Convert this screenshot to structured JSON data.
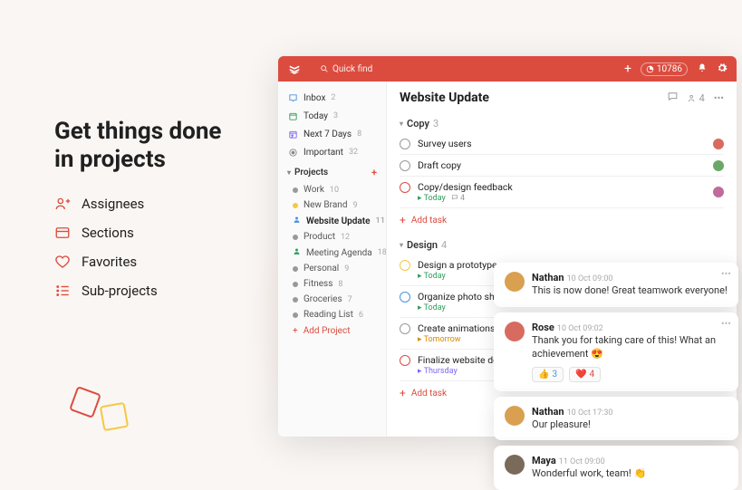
{
  "hero": {
    "title_line1": "Get things done",
    "title_line2": "in projects",
    "features": [
      {
        "icon": "assignees",
        "label": "Assignees"
      },
      {
        "icon": "sections",
        "label": "Sections"
      },
      {
        "icon": "favorites",
        "label": "Favorites"
      },
      {
        "icon": "subprojects",
        "label": "Sub-projects"
      }
    ]
  },
  "topbar": {
    "search_placeholder": "Quick find",
    "karma": "10786"
  },
  "sidebar": {
    "filters": [
      {
        "icon": "inbox",
        "label": "Inbox",
        "count": "2",
        "color": "#4a90e2"
      },
      {
        "icon": "today",
        "label": "Today",
        "count": "3",
        "color": "#2e9e5b"
      },
      {
        "icon": "next7",
        "label": "Next 7 Days",
        "count": "8",
        "color": "#7b68ee"
      },
      {
        "icon": "important",
        "label": "Important",
        "count": "32",
        "color": "#888"
      }
    ],
    "projects_header": "Projects",
    "projects": [
      {
        "label": "Work",
        "count": "10",
        "color": "#999",
        "icon": "dot"
      },
      {
        "label": "New Brand",
        "count": "9",
        "color": "#f5c842",
        "icon": "dot"
      },
      {
        "label": "Website Update",
        "count": "11",
        "color": "#4a90e2",
        "icon": "person",
        "active": true
      },
      {
        "label": "Product",
        "count": "12",
        "color": "#999",
        "icon": "dot"
      },
      {
        "label": "Meeting Agenda",
        "count": "18",
        "color": "#2e9e5b",
        "icon": "person"
      },
      {
        "label": "Personal",
        "count": "9",
        "color": "#999",
        "icon": "dot"
      },
      {
        "label": "Fitness",
        "count": "8",
        "color": "#999",
        "icon": "dot"
      },
      {
        "label": "Groceries",
        "count": "7",
        "color": "#999",
        "icon": "dot"
      },
      {
        "label": "Reading List",
        "count": "6",
        "color": "#999",
        "icon": "dot"
      }
    ],
    "add_project": "Add Project"
  },
  "main": {
    "title": "Website Update",
    "share_count": "4",
    "sections": [
      {
        "name": "Copy",
        "count": "3",
        "tasks": [
          {
            "label": "Survey users",
            "circle": "#999",
            "avatar": "#d86b5f"
          },
          {
            "label": "Draft copy",
            "circle": "#999",
            "avatar": "#6aa86a"
          },
          {
            "label": "Copy/design feedback",
            "circle": "#db4c3f",
            "date": "Today",
            "date_color": "#2e9e5b",
            "comments": "4",
            "avatar": "#c06b9a"
          }
        ],
        "add_label": "Add task"
      },
      {
        "name": "Design",
        "count": "4",
        "tasks": [
          {
            "label": "Design a prototype",
            "circle": "#f5c842",
            "date": "Today",
            "date_color": "#2e9e5b"
          },
          {
            "label": "Organize photo shoot",
            "circle": "#4a90e2",
            "date": "Today",
            "date_color": "#2e9e5b"
          },
          {
            "label": "Create animations",
            "circle": "#999",
            "date": "Tomorrow",
            "date_color": "#d28b00"
          },
          {
            "label": "Finalize website design",
            "circle": "#db4c3f",
            "date": "Thursday",
            "date_color": "#7b68ee"
          }
        ],
        "add_label": "Add task"
      }
    ]
  },
  "comments": [
    {
      "avatar": "#d8a050",
      "name": "Nathan",
      "time": "10 Oct 09:00",
      "text": "This is now done! Great teamwork everyone!",
      "dots": true
    },
    {
      "avatar": "#d86b5f",
      "name": "Rose",
      "time": "10 Oct 09:02",
      "text": "Thank you for taking care of this! What an achievement 😍",
      "dots": true,
      "reactions": [
        {
          "emoji": "👍",
          "count": "3",
          "cls": "blue"
        },
        {
          "emoji": "❤️",
          "count": "4",
          "cls": "red"
        }
      ]
    },
    {
      "avatar": "#d8a050",
      "name": "Nathan",
      "time": "10 Oct 17:30",
      "text": "Our pleasure!"
    },
    {
      "avatar": "#7a6a5a",
      "name": "Maya",
      "time": "11 Oct 09:00",
      "text": "Wonderful work, team! 👏"
    }
  ]
}
